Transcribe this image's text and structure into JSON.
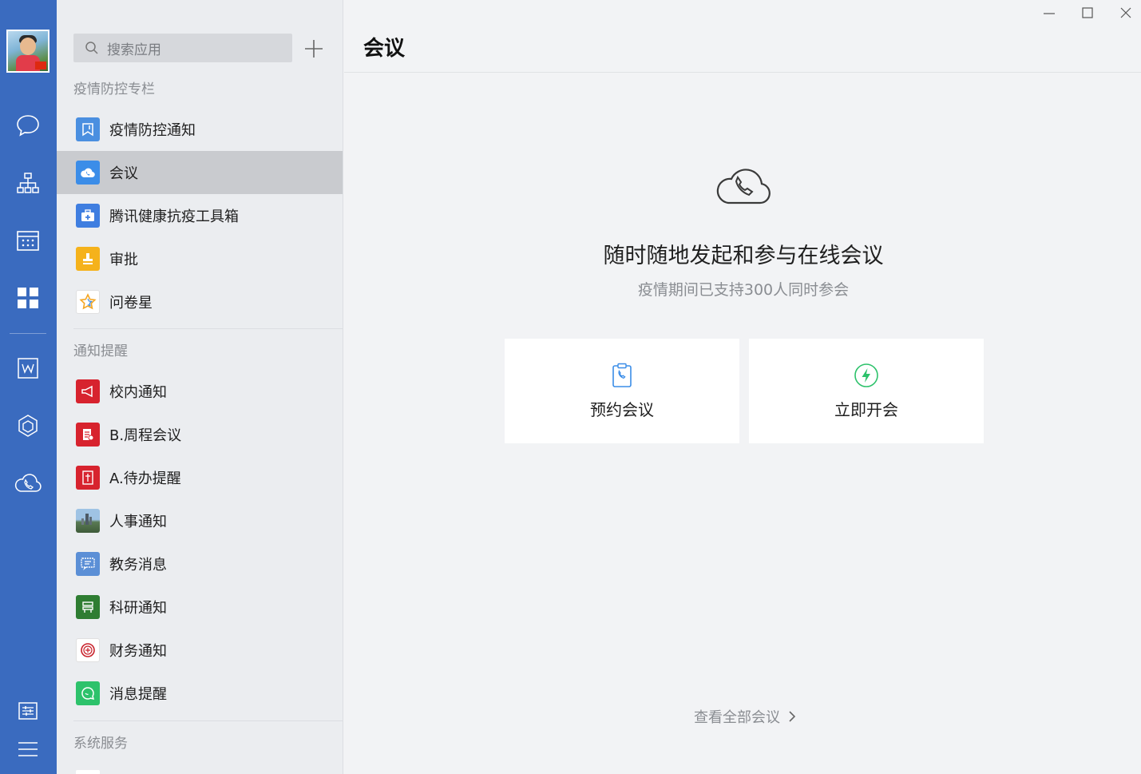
{
  "sidebar": {
    "nav_icons": [
      "chat-icon",
      "org-chart-icon",
      "calendar-icon",
      "apps-grid-icon",
      "docs-icon",
      "cube-icon",
      "cloud-phone-icon",
      "settings-sliders-icon",
      "menu-icon"
    ]
  },
  "apps": {
    "search_placeholder": "搜索应用",
    "sections": [
      {
        "title": "疫情防控专栏",
        "items": [
          {
            "label": "疫情防控通知",
            "icon": "bookmark-icon",
            "color": "#4a8fe0"
          },
          {
            "label": "会议",
            "icon": "cloud-phone-icon",
            "color": "#3b8de8",
            "active": true
          },
          {
            "label": "腾讯健康抗疫工具箱",
            "icon": "medkit-icon",
            "color": "#3f7ee0"
          },
          {
            "label": "审批",
            "icon": "stamp-icon",
            "color": "#f5b21b"
          },
          {
            "label": "问卷星",
            "icon": "star-icon",
            "color": "#ffffff"
          }
        ]
      },
      {
        "title": "通知提醒",
        "items": [
          {
            "label": "校内通知",
            "icon": "megaphone-icon",
            "color": "#d7232e"
          },
          {
            "label": "B.周程会议",
            "icon": "schedule-icon",
            "color": "#d7232e"
          },
          {
            "label": "A.待办提醒",
            "icon": "todo-icon",
            "color": "#d7232e"
          },
          {
            "label": "人事通知",
            "icon": "campus-photo-icon",
            "color": "#5a7a54"
          },
          {
            "label": "教务消息",
            "icon": "message-icon",
            "color": "#5b8fd6"
          },
          {
            "label": "科研通知",
            "icon": "lab-icon",
            "color": "#2e7d32"
          },
          {
            "label": "财务通知",
            "icon": "seal-icon",
            "color": "#ffffff"
          },
          {
            "label": "消息提醒",
            "icon": "chat-bubble-icon",
            "color": "#2dc26b"
          }
        ]
      },
      {
        "title": "系统服务",
        "items": []
      }
    ]
  },
  "main": {
    "title": "会议",
    "headline": "随时随地发起和参与在线会议",
    "subline": "疫情期间已支持300人同时参会",
    "cards": [
      {
        "label": "预约会议",
        "icon": "schedule-meeting-icon",
        "color": "#3b8de8"
      },
      {
        "label": "立即开会",
        "icon": "lightning-icon",
        "color": "#2dc26b"
      }
    ],
    "view_all": "查看全部会议"
  }
}
